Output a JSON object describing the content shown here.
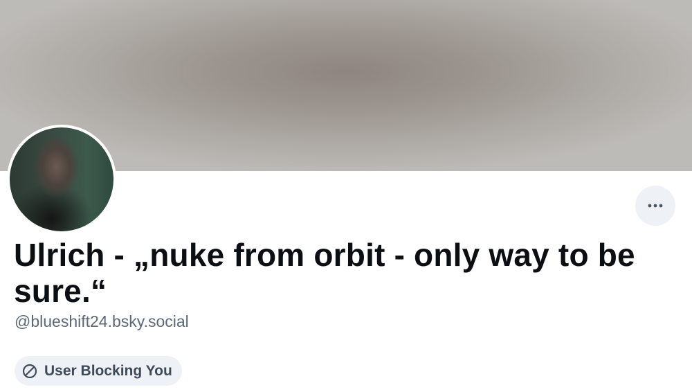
{
  "profile": {
    "display_name": "Ulrich - „nuke from orbit - only way to be sure.“",
    "handle": "@blueshift24.bsky.social",
    "block_status": "User Blocking You"
  },
  "icons": {
    "more": "more-horizontal-icon",
    "block": "circle-slash-icon"
  },
  "colors": {
    "banner": "#a39c96",
    "button_bg": "#eef1f6",
    "name_text": "#0b0f14",
    "handle_text": "#5b6878",
    "badge_text": "#3f4a58"
  }
}
